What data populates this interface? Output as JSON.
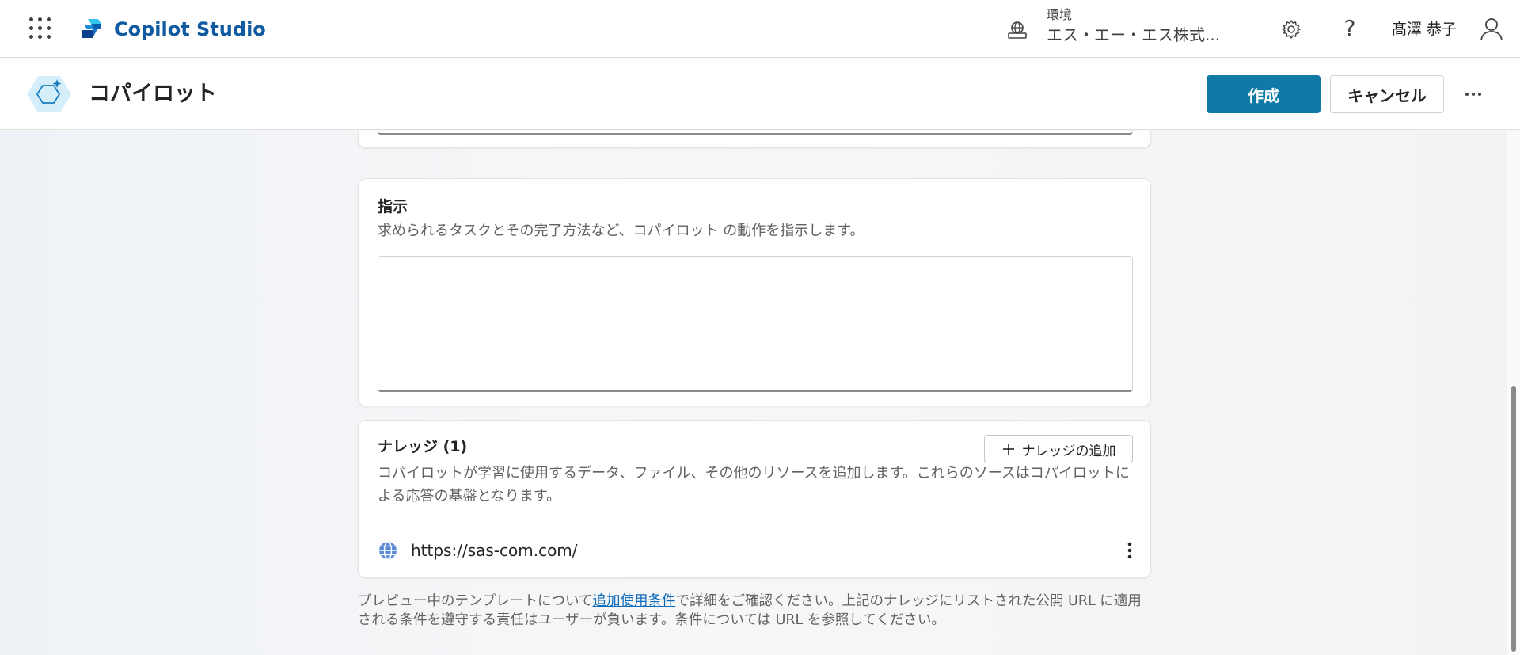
{
  "topbar": {
    "brand": "Copilot Studio",
    "environment_label": "環境",
    "environment_name": "エス・エー・エス株式...",
    "help_glyph": "?",
    "user_name": "髙澤 恭子"
  },
  "header": {
    "title": "コパイロット",
    "create_label": "作成",
    "cancel_label": "キャンセル"
  },
  "instructions": {
    "title": "指示",
    "description": "求められるタスクとその完了方法など、コパイロット の動作を指示します。",
    "value": ""
  },
  "knowledge": {
    "title": "ナレッジ (1)",
    "add_label": "ナレッジの追加",
    "description": "コパイロットが学習に使用するデータ、ファイル、その他のリソースを追加します。これらのソースはコパイロットによる応答の基盤となります。",
    "sources": [
      {
        "url": "https://sas-com.com/"
      }
    ]
  },
  "disclaimer": {
    "before": "プレビュー中のテンプレートについて",
    "link": "追加使用条件",
    "after": "で詳細をご確認ください。上記のナレッジにリストされた公開 URL に適用される条件を遵守する責任はユーザーが負います。条件については URL を参照してください。"
  },
  "colors": {
    "accent": "#0f7aa8",
    "brand_text": "#0f5aa0",
    "link": "#0f6cbd"
  },
  "icons": [
    "app-launcher-icon",
    "copilot-studio-logo",
    "environment-icon",
    "gear-icon",
    "help-icon",
    "person-icon",
    "copilot-avatar-icon",
    "more-icon",
    "plus-icon",
    "globe-icon",
    "kebab-icon"
  ]
}
